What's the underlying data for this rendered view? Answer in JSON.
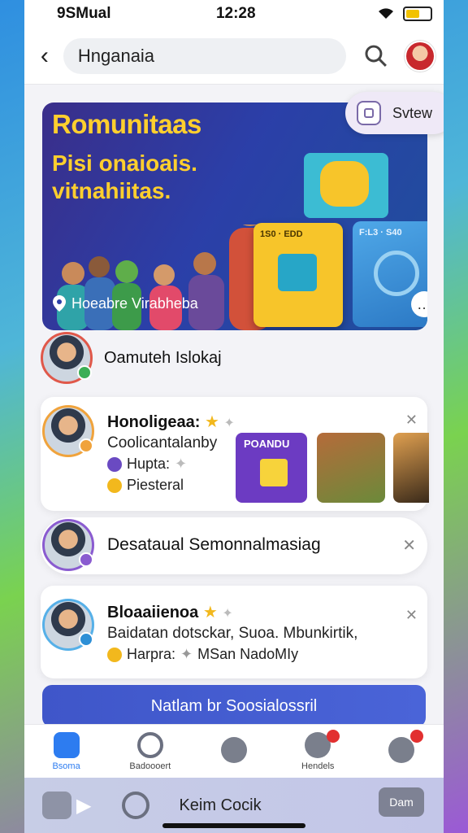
{
  "status": {
    "carrier": "9SMual",
    "time": "12:28"
  },
  "header": {
    "search_text": "Hnganaia"
  },
  "hero": {
    "title": "Romunitaas",
    "subtitle": "Pisi onaioais. vitnahiitas.",
    "location": "Hoeabre Virabheba",
    "card_yellow_label": "1S0  ·  EDD",
    "card_blue_label": "F:L3  ·  S40",
    "share_label": "Svtew"
  },
  "row_plain": {
    "name": "Oamuteh Islokaj"
  },
  "card1": {
    "title": "Honoligeaa:",
    "line2": "Coolicantalanby",
    "line3_label": "Hupta:",
    "line4_label": "Piesteral",
    "thumb_label": "POANDU"
  },
  "card2": {
    "name": "Desataual Semonnalmasiag"
  },
  "card3": {
    "title": "Bloaaiienoa",
    "line2": "Baidatan dotsckar, Suoa. Mbunkirtik,",
    "line3_label": "Harpra:",
    "line3_value": "MSan NadoMIy"
  },
  "cta": {
    "label": "Natlam br Soosialossril"
  },
  "tabs": [
    {
      "label": "Bsoma",
      "icon": "home-icon"
    },
    {
      "label": "Badoooert",
      "icon": "search-icon"
    },
    {
      "label": "",
      "icon": "add-icon"
    },
    {
      "label": "Hendels",
      "icon": "tag-icon"
    },
    {
      "label": "",
      "icon": "notification-icon"
    }
  ],
  "bottom": {
    "text": "Keim Cocik",
    "button": "Dam"
  },
  "colors": {
    "accent": "#2d7cf0",
    "cta": "#4259cf",
    "hero_text": "#ffcf2e"
  }
}
